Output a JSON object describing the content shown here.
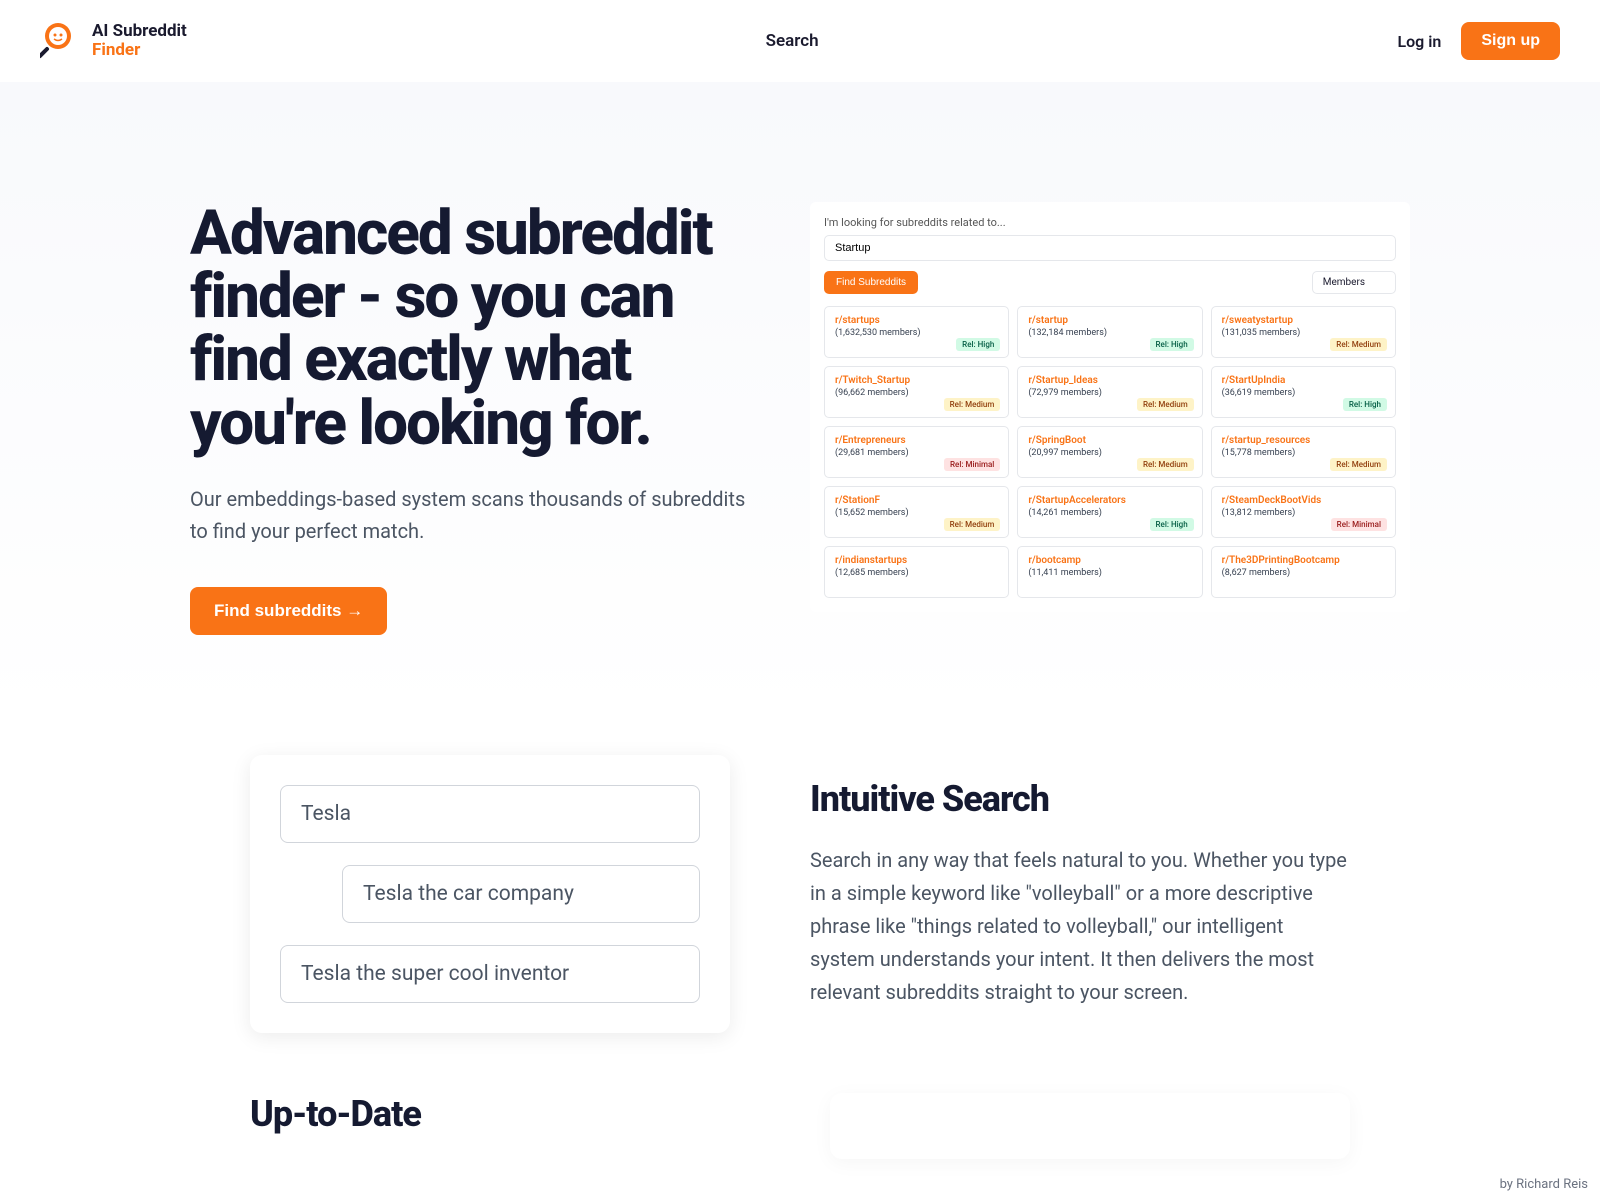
{
  "header": {
    "logo_line1": "AI Subreddit",
    "logo_line2": "Finder",
    "nav_search": "Search",
    "login": "Log in",
    "signup": "Sign up"
  },
  "hero": {
    "title": "Advanced subreddit finder - so you can find exactly what you're looking for.",
    "subtitle": "Our embeddings-based system scans thousands of subreddits to find your perfect match.",
    "cta": "Find subreddits →"
  },
  "preview": {
    "label": "I'm looking for subreddits related to...",
    "input_value": "Startup",
    "find_btn": "Find Subreddits",
    "sort": "Members",
    "results": [
      {
        "name": "r/startups",
        "members": "(1,632,530 members)",
        "rel": "Rel: High",
        "badge": "high"
      },
      {
        "name": "r/startup",
        "members": "(132,184 members)",
        "rel": "Rel: High",
        "badge": "high"
      },
      {
        "name": "r/sweatystartup",
        "members": "(131,035 members)",
        "rel": "Rel: Medium",
        "badge": "medium"
      },
      {
        "name": "r/Twitch_Startup",
        "members": "(96,662 members)",
        "rel": "Rel: Medium",
        "badge": "medium"
      },
      {
        "name": "r/Startup_Ideas",
        "members": "(72,979 members)",
        "rel": "Rel: Medium",
        "badge": "medium"
      },
      {
        "name": "r/StartUpIndia",
        "members": "(36,619 members)",
        "rel": "Rel: High",
        "badge": "high"
      },
      {
        "name": "r/Entrepreneurs",
        "members": "(29,681 members)",
        "rel": "Rel: Minimal",
        "badge": "minimal"
      },
      {
        "name": "r/SpringBoot",
        "members": "(20,997 members)",
        "rel": "Rel: Medium",
        "badge": "medium"
      },
      {
        "name": "r/startup_resources",
        "members": "(15,778 members)",
        "rel": "Rel: Medium",
        "badge": "medium"
      },
      {
        "name": "r/StationF",
        "members": "(15,652 members)",
        "rel": "Rel: Medium",
        "badge": "medium"
      },
      {
        "name": "r/StartupAccelerators",
        "members": "(14,261 members)",
        "rel": "Rel: High",
        "badge": "high"
      },
      {
        "name": "r/SteamDeckBootVids",
        "members": "(13,812 members)",
        "rel": "Rel: Minimal",
        "badge": "minimal"
      },
      {
        "name": "r/indianstartups",
        "members": "(12,685 members)",
        "rel": "",
        "badge": ""
      },
      {
        "name": "r/bootcamp",
        "members": "(11,411 members)",
        "rel": "",
        "badge": ""
      },
      {
        "name": "r/The3DPrintingBootcamp",
        "members": "(8,627 members)",
        "rel": "",
        "badge": ""
      }
    ]
  },
  "feature1": {
    "title": "Intuitive Search",
    "text": "Search in any way that feels natural to you. Whether you type in a simple keyword like \"volleyball\" or a more descriptive phrase like \"things related to volleyball,\" our intelligent system understands your intent. It then delivers the most relevant subreddits straight to your screen.",
    "examples": {
      "e1": "Tesla",
      "e2": "Tesla the car company",
      "e3": "Tesla the super cool inventor"
    }
  },
  "feature2": {
    "title": "Up-to-Date"
  },
  "footer": {
    "by": "by ",
    "author": "Richard Reis"
  }
}
